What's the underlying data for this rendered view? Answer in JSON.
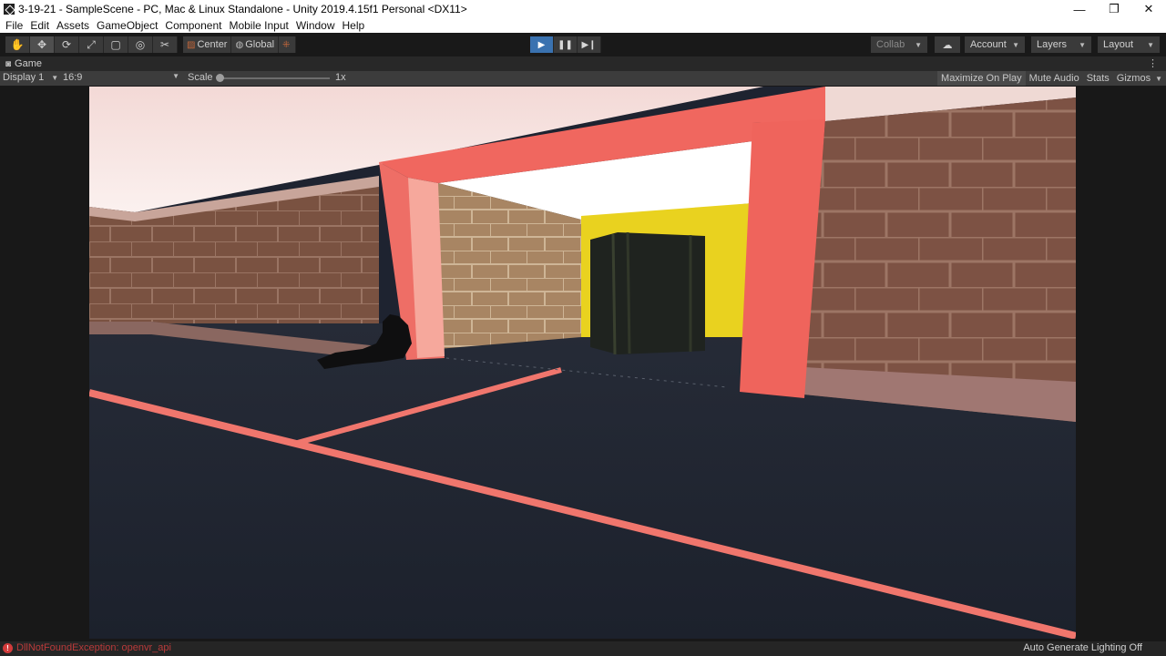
{
  "window": {
    "title": "3-19-21 - SampleScene - PC, Mac & Linux Standalone - Unity 2019.4.15f1 Personal <DX11>",
    "controls": {
      "minimize": "—",
      "restore": "❐",
      "close": "✕"
    }
  },
  "menu": [
    "File",
    "Edit",
    "Assets",
    "GameObject",
    "Component",
    "Mobile Input",
    "Window",
    "Help"
  ],
  "toolbar": {
    "transform_tools": [
      {
        "name": "hand-tool",
        "glyph": "✋"
      },
      {
        "name": "move-tool",
        "glyph": "✥"
      },
      {
        "name": "rotate-tool",
        "glyph": "⟳"
      },
      {
        "name": "scale-tool",
        "glyph": "⤢"
      },
      {
        "name": "rect-tool",
        "glyph": "▢"
      },
      {
        "name": "transform-tool",
        "glyph": "◎"
      },
      {
        "name": "custom-tool",
        "glyph": "✂"
      }
    ],
    "pivot_label": "Center",
    "handle_label": "Global",
    "play_icons": {
      "play": "▶",
      "pause": "❚❚",
      "step": "▶❙"
    },
    "collab_label": "Collab",
    "cloud_icon": "☁",
    "account_label": "Account",
    "layers_label": "Layers",
    "layout_label": "Layout"
  },
  "game_tab": {
    "label": "Game",
    "icon": "gamepad-icon"
  },
  "game_bar": {
    "display": "Display 1",
    "aspect": "16:9",
    "scale_label": "Scale",
    "scale_value": "1x",
    "maximize_label": "Maximize On Play",
    "mute_label": "Mute Audio",
    "stats_label": "Stats",
    "gizmos_label": "Gizmos"
  },
  "status": {
    "error": "DllNotFoundException: openvr_api",
    "lighting": "Auto Generate Lighting Off"
  },
  "colors": {
    "accent_play": "#3a72b0",
    "pink_frame": "#f0675f",
    "floor": "#1e2330",
    "crate": "#1f231f",
    "yellow_wall": "#e9d21f"
  }
}
